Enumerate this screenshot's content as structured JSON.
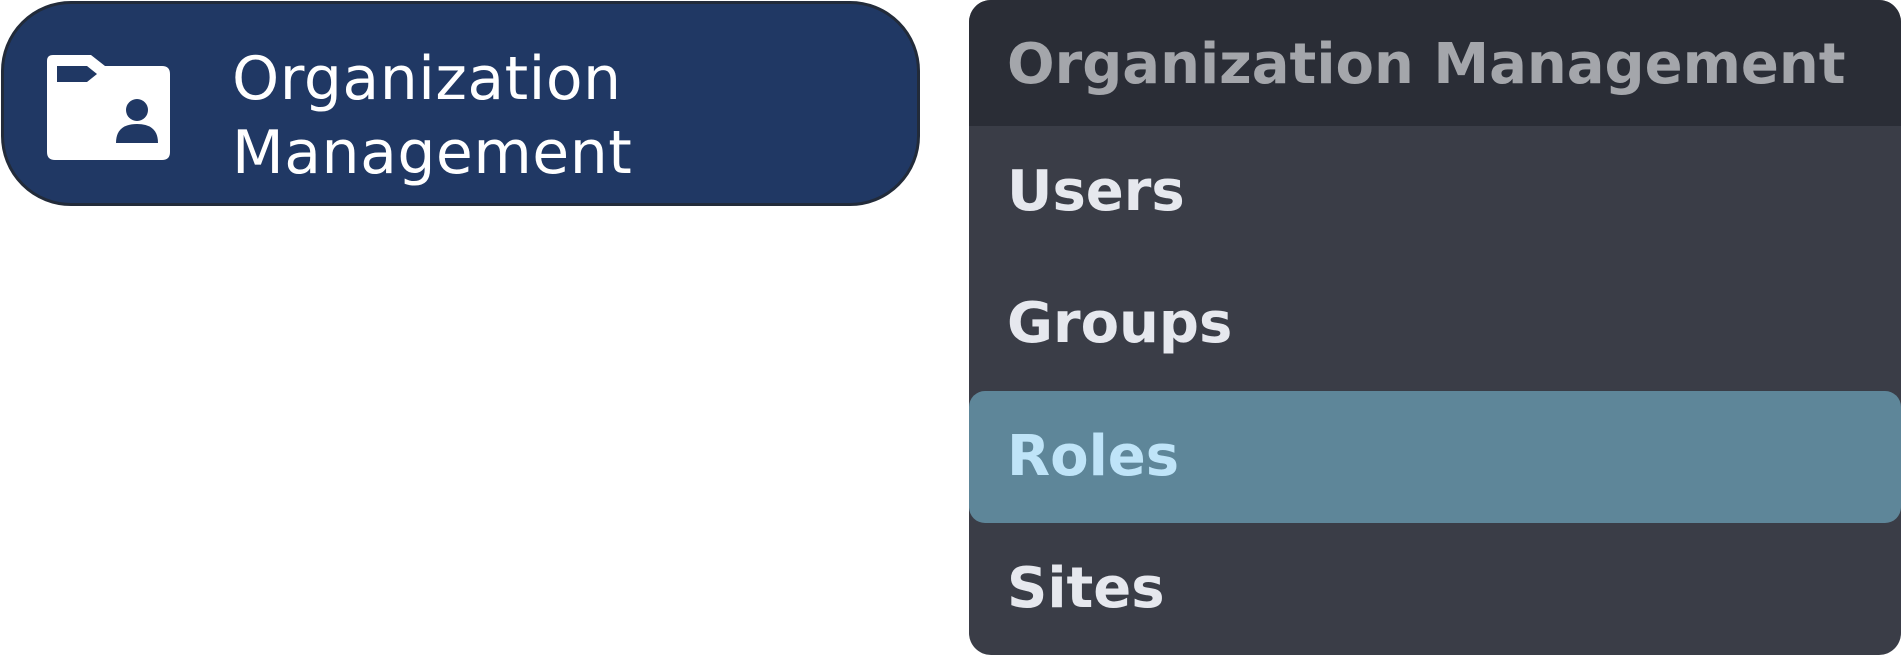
{
  "nav_button": {
    "label_line1": "Organization",
    "label_line2": "Management",
    "icon": "folder-user-icon"
  },
  "flyout": {
    "title": "Organization Management",
    "items": [
      {
        "label": "Users",
        "selected": false
      },
      {
        "label": "Groups",
        "selected": false
      },
      {
        "label": "Roles",
        "selected": true
      },
      {
        "label": "Sites",
        "selected": false
      }
    ]
  },
  "colors": {
    "nav_button_bg": "#203864",
    "flyout_bg": "#3a3d47",
    "flyout_header_bg": "#2a2d36",
    "selected_item_bg": "#5e8699",
    "selected_item_text": "#bfe4f8"
  }
}
